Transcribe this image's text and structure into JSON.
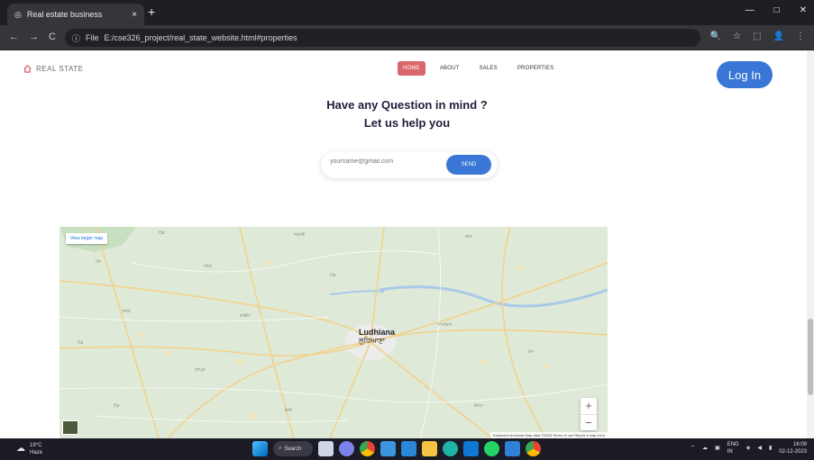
{
  "browser": {
    "tab_title": "Real estate business",
    "tab_close": "×",
    "new_tab": "+",
    "window_controls": [
      "—",
      "□",
      "✕"
    ],
    "nav": [
      "←",
      "→",
      "C"
    ],
    "address_prefix": "File",
    "address": "E:/cse326_project/real_state_website.html#properties",
    "omni_icons": [
      "🔍",
      "☆",
      "⬚",
      "👤",
      "⋮"
    ]
  },
  "site": {
    "logo_icon": "home-icon",
    "logo_text": "REAL STATE",
    "menu": [
      {
        "label": "HOME",
        "active": true
      },
      {
        "label": "ABOUT",
        "active": false
      },
      {
        "label": "SALES",
        "active": false
      },
      {
        "label": "PROPERTIES",
        "active": false
      }
    ],
    "login_label": "Log In",
    "question_line1": "Have any Question in mind ?",
    "question_line2": "Let us help you",
    "email_placeholder": "yourname@gmail.com",
    "send_label": "SEND"
  },
  "map": {
    "view_larger": "View larger map",
    "city": "Ludhiana",
    "city_local": "ਲੁਧਿਆਣਾ",
    "zoom_in": "+",
    "zoom_out": "−",
    "attribution": "Keyboard shortcuts   Map data ©2023   Terms of use   Report a map error"
  },
  "taskbar": {
    "weather_temp": "19°C",
    "weather_desc": "Haze",
    "search_label": "Search",
    "lang_line1": "ENG",
    "lang_line2": "IN",
    "time": "16:09",
    "date": "02-12-2023"
  },
  "colors": {
    "accent_blue": "#3a76d5",
    "active_menu": "#d9666a",
    "logo_red": "#d34a4a",
    "heading": "#221c3a"
  }
}
